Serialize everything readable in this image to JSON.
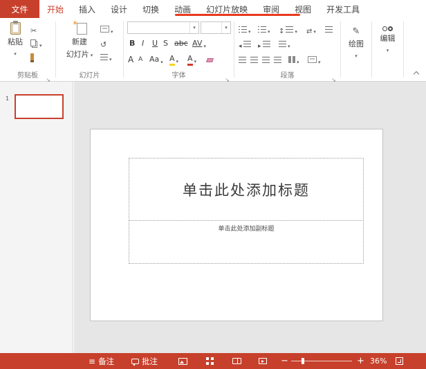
{
  "colors": {
    "accent": "#C7402B",
    "annotation_red": "#E8391E"
  },
  "tab_bar": {
    "file_label": "文件",
    "tabs": [
      {
        "label": "开始",
        "active": true
      },
      {
        "label": "插入",
        "active": false
      },
      {
        "label": "设计",
        "active": false
      },
      {
        "label": "切换",
        "active": false
      },
      {
        "label": "动画",
        "active": false
      },
      {
        "label": "幻灯片放映",
        "active": false
      },
      {
        "label": "审阅",
        "active": false
      },
      {
        "label": "视图",
        "active": false
      },
      {
        "label": "开发工具",
        "active": false
      }
    ]
  },
  "ribbon": {
    "clipboard": {
      "group_label": "剪贴板",
      "paste_label": "粘贴"
    },
    "slides": {
      "group_label": "幻灯片",
      "new_slide_line1": "新建",
      "new_slide_line2": "幻灯片"
    },
    "font": {
      "group_label": "字体",
      "font_name_value": "",
      "font_size_value": "",
      "bold_label": "B",
      "italic_label": "I",
      "underline_label": "U",
      "shadow_label": "S",
      "strike_label": "abc",
      "spacing_label": "AV",
      "grow_label": "A",
      "shrink_label": "A",
      "case_label": "Aa",
      "highlight_label": "A",
      "color_label": "A"
    },
    "paragraph": {
      "group_label": "段落"
    },
    "drawing": {
      "button_label": "绘图"
    },
    "editing": {
      "button_label": "编辑"
    }
  },
  "slides_panel": {
    "slide_number": "1"
  },
  "canvas": {
    "title_placeholder": "单击此处添加标题",
    "subtitle_placeholder": "单击此处添加副标题"
  },
  "status_bar": {
    "notes_label": "备注",
    "comments_label": "批注",
    "zoom_out_label": "−",
    "zoom_in_label": "+",
    "zoom_value": "36%"
  }
}
